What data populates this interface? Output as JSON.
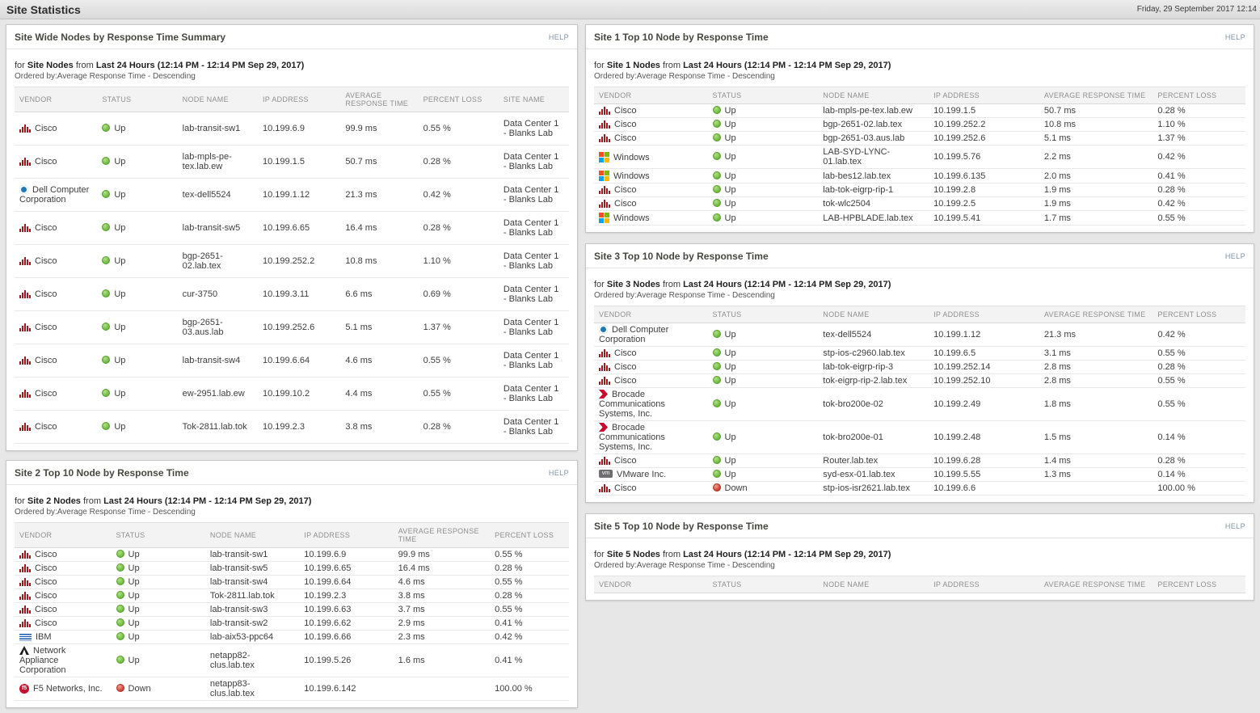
{
  "header": {
    "title": "Site Statistics",
    "datetime": "Friday, 29 September 2017 12:14"
  },
  "labels": {
    "help": "HELP"
  },
  "panels": {
    "site_wide": {
      "title": "Site Wide Nodes by Response Time Summary",
      "intro": {
        "pre": "for",
        "scope": "Site Nodes",
        "mid": "from",
        "range": "Last 24 Hours (12:14 PM - 12:14 PM Sep 29, 2017)"
      },
      "ordered_by": "Ordered by:Average Response Time - Descending",
      "columns": [
        "VENDOR",
        "STATUS",
        "NODE NAME",
        "IP ADDRESS",
        "AVERAGE RESPONSE TIME",
        "PERCENT LOSS",
        "SITE NAME"
      ],
      "fields": [
        "vendor",
        "status",
        "node_name",
        "ip_address",
        "avg_response_time",
        "percent_loss",
        "site_name"
      ],
      "rows": [
        {
          "vendor": "Cisco",
          "icon": "cisco-icon",
          "status": "Up",
          "node_name": "lab-transit-sw1",
          "ip_address": "10.199.6.9",
          "avg_response_time": "99.9 ms",
          "percent_loss": "0.55 %",
          "site_name": "Data Center 1 - Blanks Lab"
        },
        {
          "vendor": "Cisco",
          "icon": "cisco-icon",
          "status": "Up",
          "node_name": "lab-mpls-pe-tex.lab.ew",
          "ip_address": "10.199.1.5",
          "avg_response_time": "50.7 ms",
          "percent_loss": "0.28 %",
          "site_name": "Data Center 1 - Blanks Lab"
        },
        {
          "vendor": "Dell Computer Corporation",
          "icon": "dell-icon",
          "status": "Up",
          "node_name": "tex-dell5524",
          "ip_address": "10.199.1.12",
          "avg_response_time": "21.3 ms",
          "percent_loss": "0.42 %",
          "site_name": "Data Center 1 - Blanks Lab"
        },
        {
          "vendor": "Cisco",
          "icon": "cisco-icon",
          "status": "Up",
          "node_name": "lab-transit-sw5",
          "ip_address": "10.199.6.65",
          "avg_response_time": "16.4 ms",
          "percent_loss": "0.28 %",
          "site_name": "Data Center 1 - Blanks Lab"
        },
        {
          "vendor": "Cisco",
          "icon": "cisco-icon",
          "status": "Up",
          "node_name": "bgp-2651-02.lab.tex",
          "ip_address": "10.199.252.2",
          "avg_response_time": "10.8 ms",
          "percent_loss": "1.10 %",
          "site_name": "Data Center 1 - Blanks Lab"
        },
        {
          "vendor": "Cisco",
          "icon": "cisco-icon",
          "status": "Up",
          "node_name": "cur-3750",
          "ip_address": "10.199.3.11",
          "avg_response_time": "6.6 ms",
          "percent_loss": "0.69 %",
          "site_name": "Data Center 1 - Blanks Lab"
        },
        {
          "vendor": "Cisco",
          "icon": "cisco-icon",
          "status": "Up",
          "node_name": "bgp-2651-03.aus.lab",
          "ip_address": "10.199.252.6",
          "avg_response_time": "5.1 ms",
          "percent_loss": "1.37 %",
          "site_name": "Data Center 1 - Blanks Lab"
        },
        {
          "vendor": "Cisco",
          "icon": "cisco-icon",
          "status": "Up",
          "node_name": "lab-transit-sw4",
          "ip_address": "10.199.6.64",
          "avg_response_time": "4.6 ms",
          "percent_loss": "0.55 %",
          "site_name": "Data Center 1 - Blanks Lab"
        },
        {
          "vendor": "Cisco",
          "icon": "cisco-icon",
          "status": "Up",
          "node_name": "ew-2951.lab.ew",
          "ip_address": "10.199.10.2",
          "avg_response_time": "4.4 ms",
          "percent_loss": "0.55 %",
          "site_name": "Data Center 1 - Blanks Lab"
        },
        {
          "vendor": "Cisco",
          "icon": "cisco-icon",
          "status": "Up",
          "node_name": "Tok-2811.lab.tok",
          "ip_address": "10.199.2.3",
          "avg_response_time": "3.8 ms",
          "percent_loss": "0.28 %",
          "site_name": "Data Center 1 - Blanks Lab"
        }
      ]
    },
    "site2": {
      "title": "Site 2 Top 10 Node by Response Time",
      "intro": {
        "pre": "for",
        "scope": "Site 2 Nodes",
        "mid": "from",
        "range": "Last 24 Hours (12:14 PM - 12:14 PM Sep 29, 2017)"
      },
      "ordered_by": "Ordered by:Average Response Time - Descending",
      "columns": [
        "VENDOR",
        "STATUS",
        "NODE NAME",
        "IP ADDRESS",
        "AVERAGE RESPONSE TIME",
        "PERCENT LOSS"
      ],
      "fields": [
        "vendor",
        "status",
        "node_name",
        "ip_address",
        "avg_response_time",
        "percent_loss"
      ],
      "rows": [
        {
          "vendor": "Cisco",
          "icon": "cisco-icon",
          "status": "Up",
          "node_name": "lab-transit-sw1",
          "ip_address": "10.199.6.9",
          "avg_response_time": "99.9 ms",
          "percent_loss": "0.55 %"
        },
        {
          "vendor": "Cisco",
          "icon": "cisco-icon",
          "status": "Up",
          "node_name": "lab-transit-sw5",
          "ip_address": "10.199.6.65",
          "avg_response_time": "16.4 ms",
          "percent_loss": "0.28 %"
        },
        {
          "vendor": "Cisco",
          "icon": "cisco-icon",
          "status": "Up",
          "node_name": "lab-transit-sw4",
          "ip_address": "10.199.6.64",
          "avg_response_time": "4.6 ms",
          "percent_loss": "0.55 %"
        },
        {
          "vendor": "Cisco",
          "icon": "cisco-icon",
          "status": "Up",
          "node_name": "Tok-2811.lab.tok",
          "ip_address": "10.199.2.3",
          "avg_response_time": "3.8 ms",
          "percent_loss": "0.28 %"
        },
        {
          "vendor": "Cisco",
          "icon": "cisco-icon",
          "status": "Up",
          "node_name": "lab-transit-sw3",
          "ip_address": "10.199.6.63",
          "avg_response_time": "3.7 ms",
          "percent_loss": "0.55 %"
        },
        {
          "vendor": "Cisco",
          "icon": "cisco-icon",
          "status": "Up",
          "node_name": "lab-transit-sw2",
          "ip_address": "10.199.6.62",
          "avg_response_time": "2.9 ms",
          "percent_loss": "0.41 %"
        },
        {
          "vendor": "IBM",
          "icon": "ibm-icon",
          "status": "Up",
          "node_name": "lab-aix53-ppc64",
          "ip_address": "10.199.6.66",
          "avg_response_time": "2.3 ms",
          "percent_loss": "0.42 %"
        },
        {
          "vendor": "Network Appliance Corporation",
          "icon": "netapp-icon",
          "status": "Up",
          "node_name": "netapp82-clus.lab.tex",
          "ip_address": "10.199.5.26",
          "avg_response_time": "1.6 ms",
          "percent_loss": "0.41 %"
        },
        {
          "vendor": "F5 Networks, Inc.",
          "icon": "f5-icon",
          "status": "Down",
          "node_name": "netapp83-clus.lab.tex",
          "ip_address": "10.199.6.142",
          "avg_response_time": "",
          "percent_loss": "100.00 %"
        }
      ]
    },
    "site1": {
      "title": "Site 1 Top 10 Node by Response Time",
      "intro": {
        "pre": "for",
        "scope": "Site 1 Nodes",
        "mid": "from",
        "range": "Last 24 Hours (12:14 PM - 12:14 PM Sep 29, 2017)"
      },
      "ordered_by": "Ordered by:Average Response Time - Descending",
      "columns": [
        "VENDOR",
        "STATUS",
        "NODE NAME",
        "IP ADDRESS",
        "AVERAGE RESPONSE TIME",
        "PERCENT LOSS"
      ],
      "fields": [
        "vendor",
        "status",
        "node_name",
        "ip_address",
        "avg_response_time",
        "percent_loss"
      ],
      "rows": [
        {
          "vendor": "Cisco",
          "icon": "cisco-icon",
          "status": "Up",
          "node_name": "lab-mpls-pe-tex.lab.ew",
          "ip_address": "10.199.1.5",
          "avg_response_time": "50.7 ms",
          "percent_loss": "0.28 %"
        },
        {
          "vendor": "Cisco",
          "icon": "cisco-icon",
          "status": "Up",
          "node_name": "bgp-2651-02.lab.tex",
          "ip_address": "10.199.252.2",
          "avg_response_time": "10.8 ms",
          "percent_loss": "1.10 %"
        },
        {
          "vendor": "Cisco",
          "icon": "cisco-icon",
          "status": "Up",
          "node_name": "bgp-2651-03.aus.lab",
          "ip_address": "10.199.252.6",
          "avg_response_time": "5.1 ms",
          "percent_loss": "1.37 %"
        },
        {
          "vendor": "Windows",
          "icon": "windows-icon",
          "status": "Up",
          "node_name": "LAB-SYD-LYNC-01.lab.tex",
          "ip_address": "10.199.5.76",
          "avg_response_time": "2.2 ms",
          "percent_loss": "0.42 %"
        },
        {
          "vendor": "Windows",
          "icon": "windows-icon",
          "status": "Up",
          "node_name": "lab-bes12.lab.tex",
          "ip_address": "10.199.6.135",
          "avg_response_time": "2.0 ms",
          "percent_loss": "0.41 %"
        },
        {
          "vendor": "Cisco",
          "icon": "cisco-icon",
          "status": "Up",
          "node_name": "lab-tok-eigrp-rip-1",
          "ip_address": "10.199.2.8",
          "avg_response_time": "1.9 ms",
          "percent_loss": "0.28 %"
        },
        {
          "vendor": "Cisco",
          "icon": "cisco-icon",
          "status": "Up",
          "node_name": "tok-wlc2504",
          "ip_address": "10.199.2.5",
          "avg_response_time": "1.9 ms",
          "percent_loss": "0.42 %"
        },
        {
          "vendor": "Windows",
          "icon": "windows-icon",
          "status": "Up",
          "node_name": "LAB-HPBLADE.lab.tex",
          "ip_address": "10.199.5.41",
          "avg_response_time": "1.7 ms",
          "percent_loss": "0.55 %"
        }
      ]
    },
    "site3": {
      "title": "Site 3 Top 10 Node by Response Time",
      "intro": {
        "pre": "for",
        "scope": "Site 3 Nodes",
        "mid": "from",
        "range": "Last 24 Hours (12:14 PM - 12:14 PM Sep 29, 2017)"
      },
      "ordered_by": "Ordered by:Average Response Time - Descending",
      "columns": [
        "VENDOR",
        "STATUS",
        "NODE NAME",
        "IP ADDRESS",
        "AVERAGE RESPONSE TIME",
        "PERCENT LOSS"
      ],
      "fields": [
        "vendor",
        "status",
        "node_name",
        "ip_address",
        "avg_response_time",
        "percent_loss"
      ],
      "rows": [
        {
          "vendor": "Dell Computer Corporation",
          "icon": "dell-icon",
          "status": "Up",
          "node_name": "tex-dell5524",
          "ip_address": "10.199.1.12",
          "avg_response_time": "21.3 ms",
          "percent_loss": "0.42 %"
        },
        {
          "vendor": "Cisco",
          "icon": "cisco-icon",
          "status": "Up",
          "node_name": "stp-ios-c2960.lab.tex",
          "ip_address": "10.199.6.5",
          "avg_response_time": "3.1 ms",
          "percent_loss": "0.55 %"
        },
        {
          "vendor": "Cisco",
          "icon": "cisco-icon",
          "status": "Up",
          "node_name": "lab-tok-eigrp-rip-3",
          "ip_address": "10.199.252.14",
          "avg_response_time": "2.8 ms",
          "percent_loss": "0.28 %"
        },
        {
          "vendor": "Cisco",
          "icon": "cisco-icon",
          "status": "Up",
          "node_name": "tok-eigrp-rip-2.lab.tex",
          "ip_address": "10.199.252.10",
          "avg_response_time": "2.8 ms",
          "percent_loss": "0.55 %"
        },
        {
          "vendor": "Brocade Communications Systems, Inc.",
          "icon": "brocade-icon",
          "status": "Up",
          "node_name": "tok-bro200e-02",
          "ip_address": "10.199.2.49",
          "avg_response_time": "1.8 ms",
          "percent_loss": "0.55 %"
        },
        {
          "vendor": "Brocade Communications Systems, Inc.",
          "icon": "brocade-icon",
          "status": "Up",
          "node_name": "tok-bro200e-01",
          "ip_address": "10.199.2.48",
          "avg_response_time": "1.5 ms",
          "percent_loss": "0.14 %"
        },
        {
          "vendor": "Cisco",
          "icon": "cisco-icon",
          "status": "Up",
          "node_name": "Router.lab.tex",
          "ip_address": "10.199.6.28",
          "avg_response_time": "1.4 ms",
          "percent_loss": "0.28 %"
        },
        {
          "vendor": "VMware Inc.",
          "icon": "vmware-icon",
          "status": "Up",
          "node_name": "syd-esx-01.lab.tex",
          "ip_address": "10.199.5.55",
          "avg_response_time": "1.3 ms",
          "percent_loss": "0.14 %"
        },
        {
          "vendor": "Cisco",
          "icon": "cisco-icon",
          "status": "Down",
          "node_name": "stp-ios-isr2621.lab.tex",
          "ip_address": "10.199.6.6",
          "avg_response_time": "",
          "percent_loss": "100.00 %"
        }
      ]
    },
    "site5": {
      "title": "Site 5 Top 10 Node by Response Time",
      "intro": {
        "pre": "for",
        "scope": "Site 5 Nodes",
        "mid": "from",
        "range": "Last 24 Hours (12:14 PM - 12:14 PM Sep 29, 2017)"
      },
      "ordered_by": "Ordered by:Average Response Time - Descending",
      "columns": [
        "VENDOR",
        "STATUS",
        "NODE NAME",
        "IP ADDRESS",
        "AVERAGE RESPONSE TIME",
        "PERCENT LOSS"
      ],
      "fields": [
        "vendor",
        "status",
        "node_name",
        "ip_address",
        "avg_response_time",
        "percent_loss"
      ],
      "rows": []
    }
  }
}
